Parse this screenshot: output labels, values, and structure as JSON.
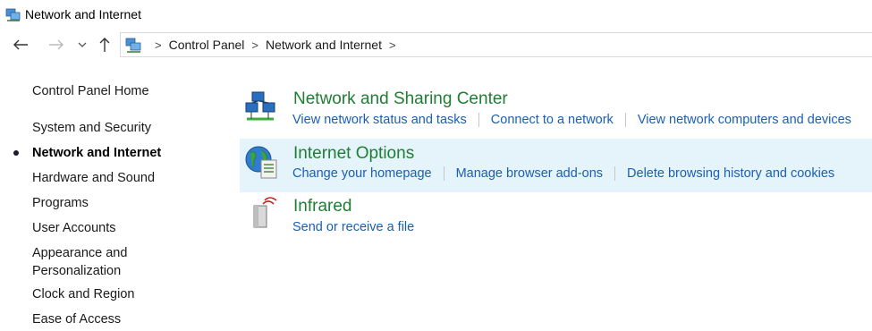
{
  "window": {
    "title": "Network and Internet"
  },
  "nav": {
    "back_icon": "arrow-left-icon",
    "forward_icon": "arrow-right-icon",
    "recent_icon": "chevron-down-icon",
    "up_icon": "arrow-up-icon",
    "breadcrumb": [
      "Control Panel",
      "Network and Internet"
    ]
  },
  "sidebar": {
    "items": [
      {
        "label": "Control Panel Home"
      },
      {
        "label": "System and Security"
      },
      {
        "label": "Network and Internet",
        "active": true
      },
      {
        "label": "Hardware and Sound"
      },
      {
        "label": "Programs"
      },
      {
        "label": "User Accounts"
      },
      {
        "label": "Appearance and",
        "label2": "Personalization"
      },
      {
        "label": "Clock and Region"
      },
      {
        "label": "Ease of Access"
      }
    ]
  },
  "categories": [
    {
      "title": "Network and Sharing Center",
      "icon": "network-sharing-icon",
      "links": [
        "View network status and tasks",
        "Connect to a network",
        "View network computers and devices"
      ]
    },
    {
      "title": "Internet Options",
      "icon": "globe-icon",
      "highlighted": true,
      "links": [
        "Change your homepage",
        "Manage browser add-ons",
        "Delete browsing history and cookies"
      ]
    },
    {
      "title": "Infrared",
      "icon": "infrared-icon",
      "links": [
        "Send or receive a file"
      ]
    }
  ],
  "colors": {
    "title_green": "#1e7e34",
    "link_blue": "#1a5fb4",
    "hover_bg": "#e5f3fb"
  }
}
